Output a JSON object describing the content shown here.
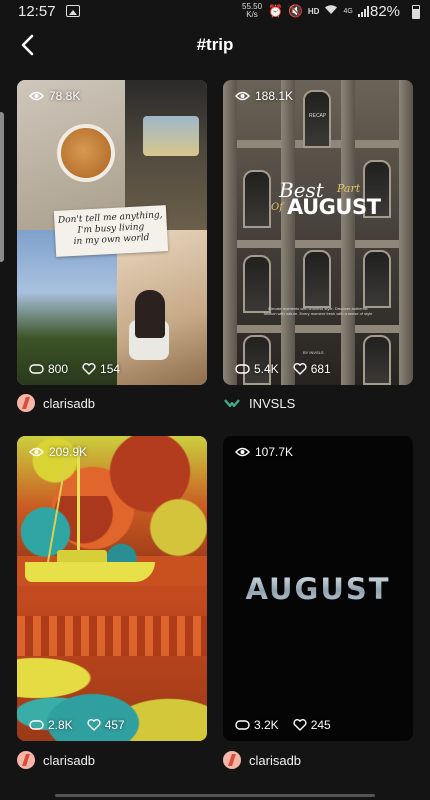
{
  "status_bar": {
    "time": "12:57",
    "net_speed_value": "55.50",
    "net_speed_unit": "K/s",
    "hd_label": "HD",
    "network_type": "4G",
    "battery_percent": "82%"
  },
  "header": {
    "title": "#trip"
  },
  "posts": [
    {
      "views": "78.8K",
      "reposts": "800",
      "likes": "154",
      "author": "clarisadb",
      "overlay_lines": [
        "Don't tell me anything,",
        "I'm busy living",
        "in my own world"
      ]
    },
    {
      "views": "188.1K",
      "reposts": "5.4K",
      "likes": "681",
      "author": "INVSLS",
      "overlay": {
        "best": "Best",
        "part": "Part",
        "of": "Of",
        "august": "AUGUST",
        "recap": "RECAP",
        "fine_print": "Elevate moments with timeless style. Discover authentic fashion with nature. Every moment fresh with a sense of style",
        "brand": "BY INVSLS"
      }
    },
    {
      "views": "209.9K",
      "reposts": "2.8K",
      "likes": "457",
      "author": "clarisadb"
    },
    {
      "views": "107.7K",
      "reposts": "3.2K",
      "likes": "245",
      "author": "clarisadb",
      "overlay_title": "AUGUST"
    }
  ],
  "icons": {
    "back": "back-arrow-icon",
    "views": "eye-icon",
    "reposts": "repost-icon",
    "likes": "heart-icon"
  },
  "colors": {
    "background": "#141414",
    "text": "#ffffff",
    "august_silver": "#b3c2cc",
    "brand_gold": "#e0c36b"
  }
}
